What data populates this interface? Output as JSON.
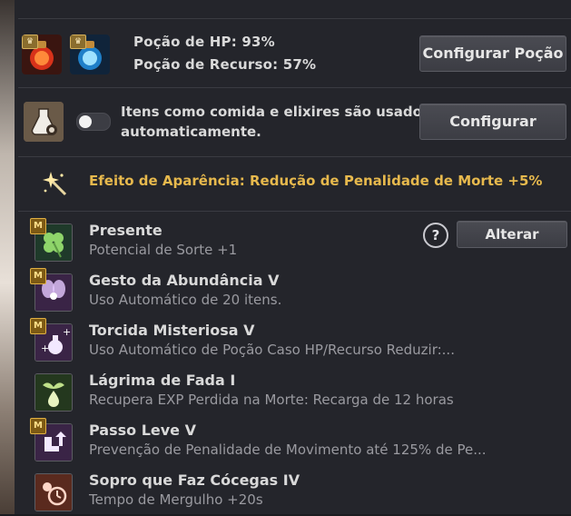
{
  "potion": {
    "hp_label": "Poção de HP: 93%",
    "resource_label": "Poção de Recurso: 57%",
    "config_button": "Configurar Poção",
    "hp_icon": "red-potion-icon",
    "resource_icon": "blue-potion-icon"
  },
  "auto_use": {
    "icon": "flask-gear-icon",
    "toggle_on": false,
    "line1": "Itens como comida e elixires são usados",
    "line2": "automaticamente.",
    "button": "Configurar"
  },
  "appearance": {
    "icon": "sparkle-wand-icon",
    "text": "Efeito de Aparência: Redução de Penalidade de Morte +5%"
  },
  "actions": {
    "help": "?",
    "change_button": "Alterar"
  },
  "skills": [
    {
      "badge": "M",
      "icon": "clover-icon",
      "name": "Presente",
      "desc": "Potencial de Sorte +1"
    },
    {
      "badge": "M",
      "icon": "fairy-icon",
      "name": "Gesto da Abundância V",
      "desc": "Uso Automático de 20 itens."
    },
    {
      "badge": "M",
      "icon": "potion-plus-icon",
      "name": "Torcida Misteriosa V",
      "desc": "Uso Automático de Poção Caso HP/Recurso Reduzir:..."
    },
    {
      "badge": "",
      "icon": "angel-tear-icon",
      "name": "Lágrima de Fada I",
      "desc": "Recupera EXP Perdida na Morte: Recarga de 12 horas"
    },
    {
      "badge": "M",
      "icon": "boot-arrow-icon",
      "name": "Passo Leve V",
      "desc": "Prevenção de Penalidade de Movimento até 125% de Pe..."
    },
    {
      "badge": "",
      "icon": "breath-clock-icon",
      "name": "Sopro que Faz Cócegas IV",
      "desc": "Tempo de Mergulho +20s"
    }
  ],
  "colors": {
    "accent_gold": "#e7b94d",
    "panel": "#24252b"
  }
}
